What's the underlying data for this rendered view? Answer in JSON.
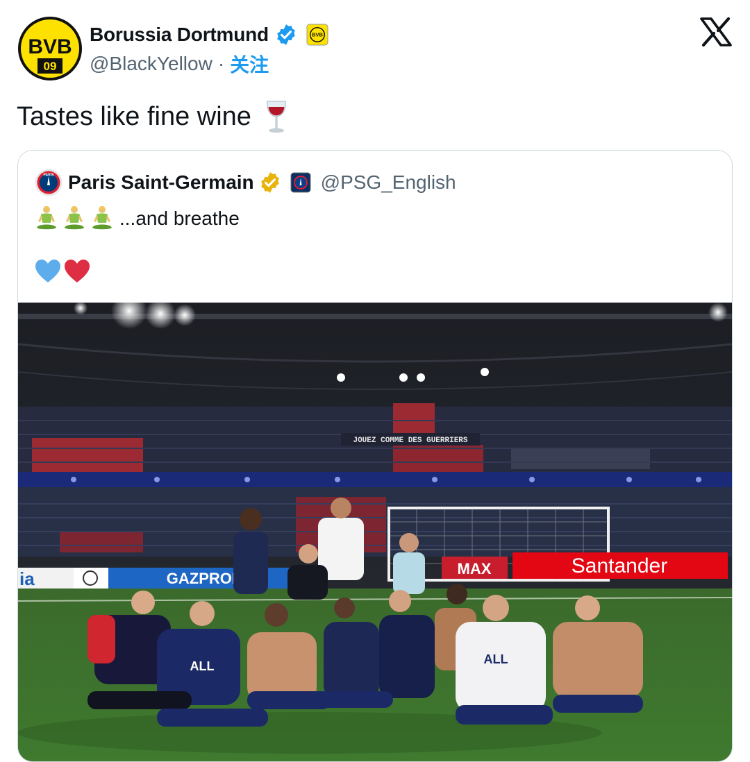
{
  "author": {
    "name": "Borussia Dortmund",
    "handle": "@BlackYellow",
    "separator": "·",
    "follow_label": "关注",
    "avatar_text": "BVB",
    "avatar_year": "09",
    "verified_color": "#1d9bf0",
    "brand_color": "#fde100"
  },
  "tweet": {
    "text": "Tastes like fine wine",
    "emoji_icon": "wine-glass-icon"
  },
  "quoted": {
    "name": "Paris Saint-Germain",
    "handle": "@PSG_English",
    "text": "...and breathe",
    "leading_icons": [
      "person-in-lotus-position-icon",
      "person-in-lotus-position-icon",
      "person-in-lotus-position-icon"
    ],
    "heart_icons": [
      "blue-heart-icon",
      "red-heart-icon"
    ],
    "verified_color": "#e8b30c",
    "avatar_text": "PARIS"
  },
  "photo": {
    "banner_text": "JOUEZ COMME DES GUERRIERS",
    "sponsor_1": "GAZPROM",
    "sponsor_2": "Santander",
    "sponsor_3": "ia",
    "jersey_text": "ALL",
    "ad_text": "MAX"
  }
}
